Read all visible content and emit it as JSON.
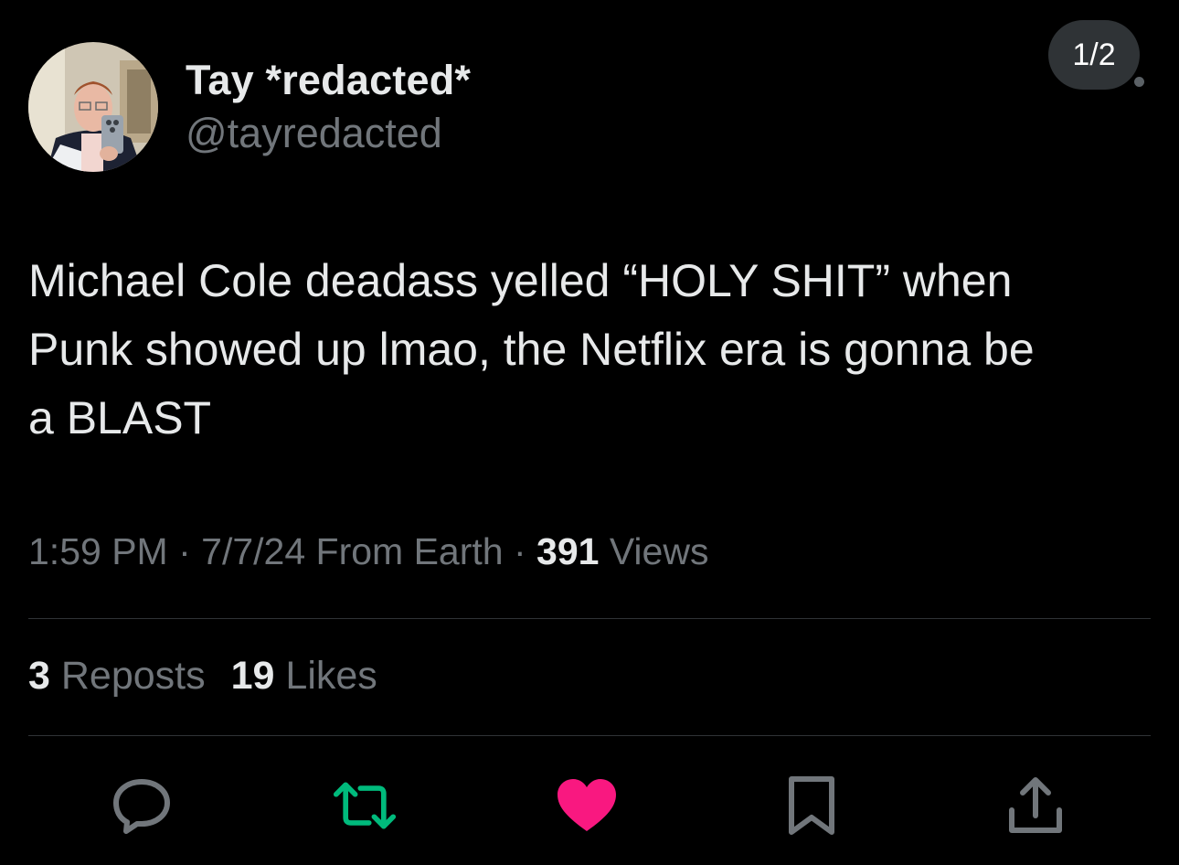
{
  "header": {
    "page_indicator": "1/2"
  },
  "author": {
    "display_name": "Tay *redacted*",
    "handle": "@tayredacted",
    "avatar_icon": "user-avatar-photo"
  },
  "tweet": {
    "text_lines": [
      "Michael Cole deadass yelled “HOLY SHIT” when",
      "Punk showed up lmao, the Netflix era is gonna be",
      "a BLAST"
    ]
  },
  "meta": {
    "time": "1:59 PM",
    "sep1": " · ",
    "date": "7/7/24",
    "location": " From Earth",
    "sep2": " · ",
    "views_count": "391",
    "views_label": " Views"
  },
  "stats": {
    "reposts_count": "3",
    "reposts_label": " Reposts",
    "likes_count": "19",
    "likes_label": " Likes"
  },
  "actions": [
    {
      "name": "reply",
      "icon": "reply-icon",
      "color": "#71767b"
    },
    {
      "name": "repost",
      "icon": "repost-icon",
      "color": "#00ba7c"
    },
    {
      "name": "like",
      "icon": "heart-icon",
      "color": "#f91880"
    },
    {
      "name": "bookmark",
      "icon": "bookmark-icon",
      "color": "#71767b"
    },
    {
      "name": "share",
      "icon": "share-icon",
      "color": "#71767b"
    }
  ]
}
